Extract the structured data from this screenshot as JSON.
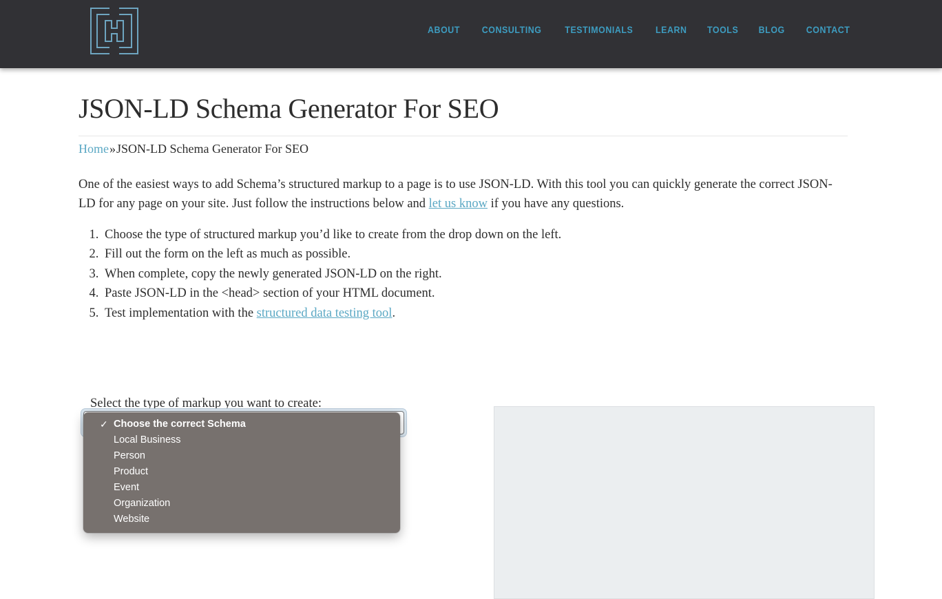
{
  "header": {
    "logo_name": "hierarchy-maze-logo",
    "nav": [
      {
        "label": "ABOUT"
      },
      {
        "label": "CONSULTING"
      },
      {
        "label": "TESTIMONIALS"
      },
      {
        "label": "LEARN"
      },
      {
        "label": "TOOLS"
      },
      {
        "label": "BLOG"
      },
      {
        "label": "CONTACT"
      }
    ],
    "background_color": "#313135",
    "link_color": "#3d9cc0"
  },
  "page": {
    "title": "JSON-LD Schema Generator For SEO",
    "breadcrumb": {
      "home_label": "Home",
      "separator": "»",
      "current": "JSON-LD Schema Generator For SEO"
    },
    "intro": {
      "part1": "One of the easiest ways to add Schema’s structured markup to a page is to use JSON-LD. With this tool you can quickly generate the correct JSON-LD for any page on your site. Just follow the instructions below and ",
      "link_label": "let us know",
      "part2": " if you have any questions."
    },
    "steps": [
      {
        "text": "Choose the type of structured markup you’d like to create from the drop down on the left."
      },
      {
        "text": "Fill out the form on the left as much as possible."
      },
      {
        "text": "When complete, copy the newly generated JSON-LD on the right."
      },
      {
        "text": "Paste JSON-LD in the <head> section of your HTML document."
      }
    ],
    "step5": {
      "prefix": "Test implementation with the ",
      "link_label": "structured data testing tool",
      "suffix": "."
    },
    "link_color": "#5ba8c4"
  },
  "form": {
    "select_label": "Select the type of markup you want to create:",
    "selected_value": "Choose the correct Schema",
    "dropdown_open": true,
    "dropdown_background": "#77716e",
    "checkmark": "✓",
    "options": [
      {
        "label": "Choose the correct Schema",
        "selected": true
      },
      {
        "label": "Local Business",
        "selected": false
      },
      {
        "label": "Person",
        "selected": false
      },
      {
        "label": "Product",
        "selected": false
      },
      {
        "label": "Event",
        "selected": false
      },
      {
        "label": "Organization",
        "selected": false
      },
      {
        "label": "Website",
        "selected": false
      }
    ]
  },
  "output": {
    "content": "",
    "background_color": "#ebeef0"
  }
}
